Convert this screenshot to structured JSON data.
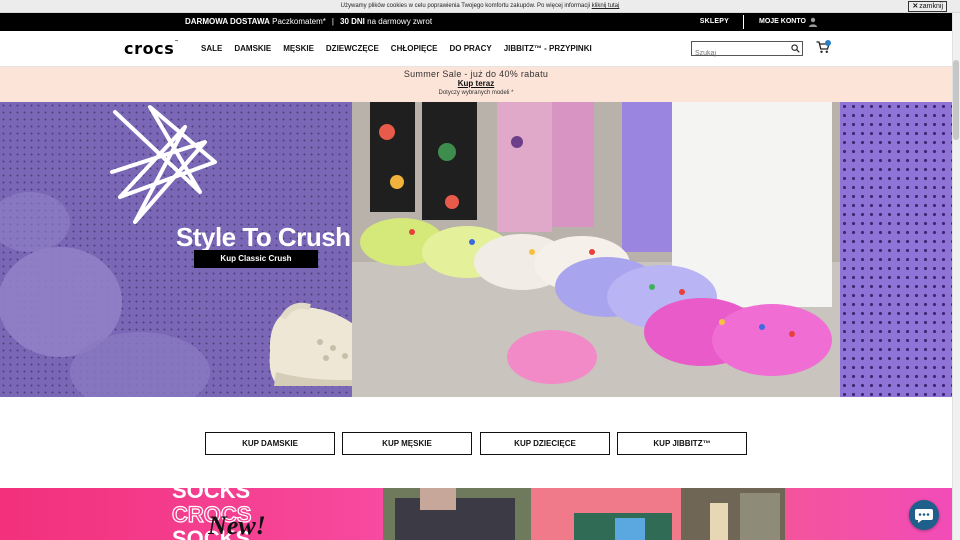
{
  "cookie": {
    "text": "Używamy plików cookies w celu poprawienia Twojego komfortu zakupów. Po więcej informacji ",
    "link": "kliknij tutaj",
    "close_label": "zamknij"
  },
  "promo": {
    "delivery_bold": "DARMOWA DOSTAWA",
    "delivery_rest": " Paczkomatem*",
    "separator": "|",
    "returns_bold": "30 DNI",
    "returns_rest": " na darmowy zwrot",
    "stores": "SKLEPY",
    "account": "MOJE KONTO"
  },
  "header": {
    "logo": "crocs",
    "nav": [
      "SALE",
      "DAMSKIE",
      "MĘSKIE",
      "DZIEWCZĘCE",
      "CHŁOPIĘCE",
      "DO PRACY",
      "JIBBITZ™ - PRZYPINKI"
    ],
    "search_placeholder": "Szukaj"
  },
  "sale_banner": {
    "title": "Summer Sale - już do 40% rabatu",
    "cta": "Kup teraz",
    "note": "Dotyczy wybranych modeli *"
  },
  "hero": {
    "headline": "Style To Crush",
    "cta": "Kup Classic Crush"
  },
  "categories": [
    "KUP DAMSKIE",
    "KUP MĘSKIE",
    "KUP DZIECIĘCE",
    "KUP JIBBITZ™"
  ],
  "bottom": {
    "stack_text": [
      "SOCKS",
      "CROCS",
      "SOCKS"
    ],
    "badge": "New!"
  },
  "colors": {
    "hero_left": "#7a67b6",
    "hero_right": "#8f73d6",
    "sale_bg": "#fde4d9",
    "chat": "#1f5f8b",
    "pink": "#f2307b"
  },
  "icons": [
    "search-icon",
    "cart-icon",
    "user-icon",
    "close-icon",
    "chat-icon"
  ]
}
